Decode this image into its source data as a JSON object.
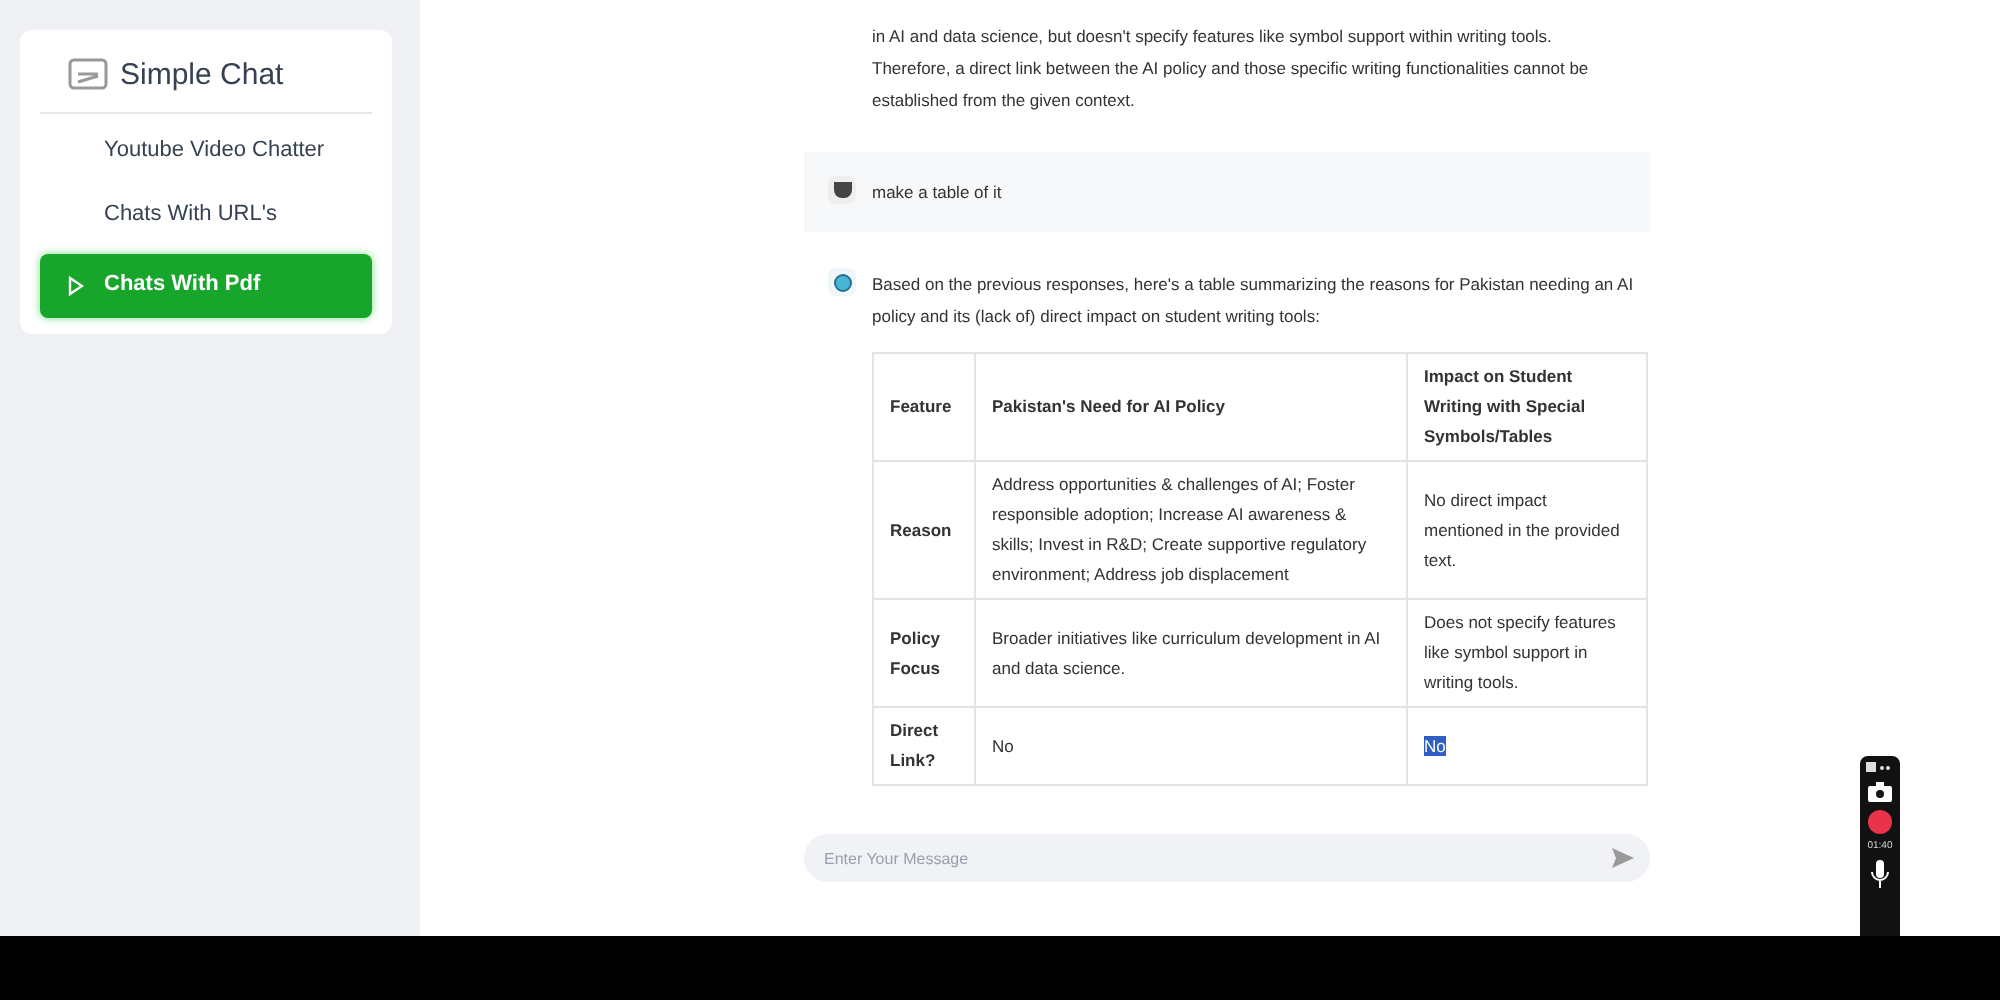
{
  "sidebar": {
    "title": "Simple Chat",
    "items": [
      {
        "label": "Youtube Video Chatter",
        "selected": false
      },
      {
        "label": "Chats With URL's",
        "selected": false
      },
      {
        "label": "Chats With Pdf",
        "selected": true
      }
    ]
  },
  "messages": [
    {
      "kind": "text",
      "from_user": false,
      "text": "in AI and data science, but doesn't specify features like symbol support within writing tools. Therefore, a direct link between the AI policy and those specific writing functionalities cannot be established from the given context."
    },
    {
      "kind": "text",
      "from_user": true,
      "text": "make a table of it"
    },
    {
      "kind": "table",
      "from_user": false,
      "text": "Based on the previous responses, here's a table summarizing the reasons for Pakistan needing an AI policy and its (lack of) direct impact on student writing tools:",
      "table": {
        "columns": [
          "Feature",
          "Pakistan's Need for AI Policy",
          "Impact on Student Writing with Special Symbols/Tables"
        ],
        "rows": [
          [
            {
              "text": "Reason"
            },
            {
              "text": "Address opportunities & challenges of AI; Foster responsible adoption; Increase AI awareness & skills; Invest in R&D; Create supportive regulatory environment; Address job displacement"
            },
            {
              "text": "No direct impact mentioned in the provided text."
            }
          ],
          [
            {
              "text": "Policy Focus"
            },
            {
              "text": "Broader initiatives like curriculum development in AI and data science."
            },
            {
              "text": "Does not specify features like symbol support in writing tools."
            }
          ],
          [
            {
              "text": "Direct Link?"
            },
            {
              "text": "No"
            },
            {
              "text": "No",
              "selected": true
            }
          ]
        ]
      }
    }
  ],
  "input": {
    "placeholder": "Enter Your Message"
  },
  "recorder": {
    "time": "01:40"
  }
}
